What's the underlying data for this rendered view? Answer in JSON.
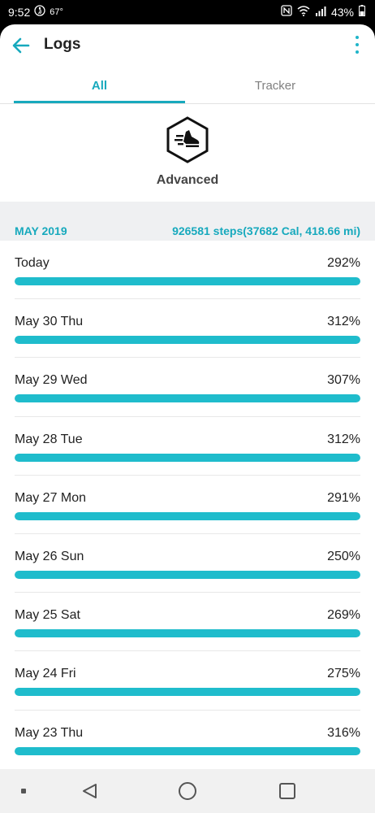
{
  "status_bar": {
    "time": "9:52",
    "temperature": "67°",
    "battery": "43%",
    "icons": [
      "step-counter-icon",
      "nfc-icon",
      "wifi-icon",
      "signal-icon",
      "battery-icon"
    ]
  },
  "header": {
    "title": "Logs",
    "back_icon": "arrow-left-icon",
    "menu_icon": "more-vert-icon"
  },
  "tabs": [
    {
      "label": "All",
      "selected": true
    },
    {
      "label": "Tracker",
      "selected": false
    }
  ],
  "mode": {
    "label": "Advanced",
    "icon": "running-shoe-icon"
  },
  "summary": {
    "month": "MAY 2019",
    "total": "926581 steps(37682 Cal, 418.66 mi)"
  },
  "logs": [
    {
      "date": "Today",
      "percent": "292%",
      "fill": 1.0
    },
    {
      "date": "May 30 Thu",
      "percent": "312%",
      "fill": 1.0
    },
    {
      "date": "May 29 Wed",
      "percent": "307%",
      "fill": 1.0
    },
    {
      "date": "May 28 Tue",
      "percent": "312%",
      "fill": 1.0
    },
    {
      "date": "May 27 Mon",
      "percent": "291%",
      "fill": 1.0
    },
    {
      "date": "May 26 Sun",
      "percent": "250%",
      "fill": 1.0
    },
    {
      "date": "May 25 Sat",
      "percent": "269%",
      "fill": 1.0
    },
    {
      "date": "May 24 Fri",
      "percent": "275%",
      "fill": 1.0
    },
    {
      "date": "May 23 Thu",
      "percent": "316%",
      "fill": 1.0
    }
  ],
  "colors": {
    "accent": "#17a9bd",
    "bar_fill": "#1fbccc",
    "summary_bg": "#eff0f2"
  },
  "nav_bar": {
    "icons": [
      "recent-dot-icon",
      "back-triangle-icon",
      "home-circle-icon",
      "overview-square-icon"
    ]
  }
}
